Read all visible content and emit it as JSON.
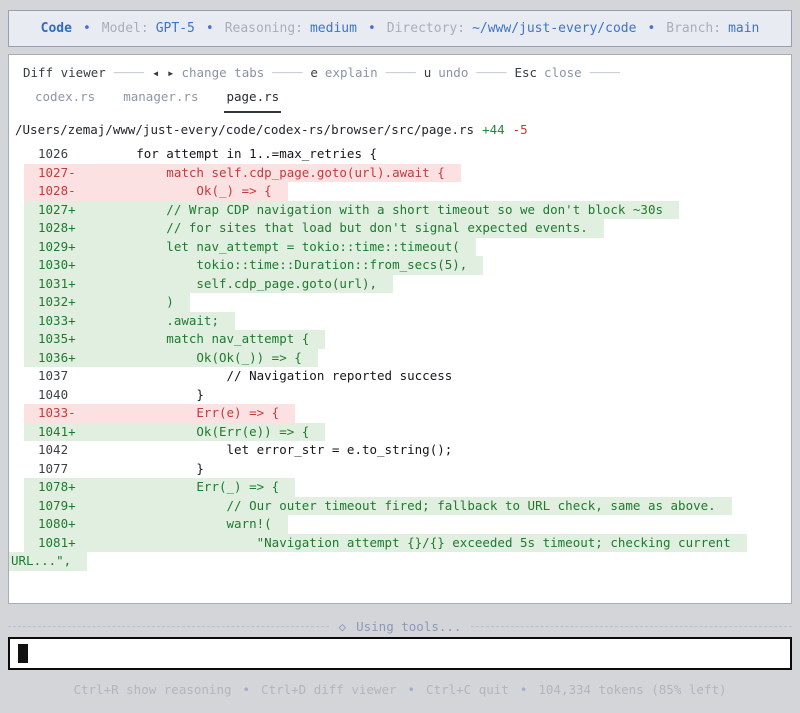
{
  "header": {
    "app": "Code",
    "bullet": "•",
    "items": [
      {
        "label": "Model:",
        "value": "GPT-5"
      },
      {
        "label": "Reasoning:",
        "value": "medium"
      },
      {
        "label": "Directory:",
        "value": "~/www/just-every/code"
      },
      {
        "label": "Branch:",
        "value": "main"
      }
    ]
  },
  "diff_viewer": {
    "title": "Diff viewer",
    "dash": "────",
    "hints": [
      {
        "key": "◂ ▸",
        "action": "change tabs"
      },
      {
        "key": "e",
        "action": "explain"
      },
      {
        "key": "u",
        "action": "undo"
      },
      {
        "key": "Esc",
        "action": "close"
      }
    ],
    "tabs": [
      {
        "label": "codex.rs"
      },
      {
        "label": "manager.rs"
      },
      {
        "label": "page.rs"
      }
    ],
    "file_path": "/Users/zemaj/www/just-every/code/codex-rs/browser/src/page.rs",
    "additions": "+44",
    "deletions": "-5",
    "lines": [
      {
        "num": "1026",
        "type": "ctx",
        "text": "        for attempt in 1..=max_retries {"
      },
      {
        "num": "1027-",
        "type": "del",
        "text": "            match self.cdp_page.goto(url).await {"
      },
      {
        "num": "1028-",
        "type": "del",
        "text": "                Ok(_) => {"
      },
      {
        "num": "1027+",
        "type": "add",
        "text": "            // Wrap CDP navigation with a short timeout so we don't block ~30s"
      },
      {
        "num": "1028+",
        "type": "add",
        "text": "            // for sites that load but don't signal expected events."
      },
      {
        "num": "1029+",
        "type": "add",
        "text": "            let nav_attempt = tokio::time::timeout("
      },
      {
        "num": "1030+",
        "type": "add",
        "text": "                tokio::time::Duration::from_secs(5),"
      },
      {
        "num": "1031+",
        "type": "add",
        "text": "                self.cdp_page.goto(url),"
      },
      {
        "num": "1032+",
        "type": "add",
        "text": "            )"
      },
      {
        "num": "1033+",
        "type": "add",
        "text": "            .await;"
      },
      {
        "num": "1035+",
        "type": "add",
        "text": "            match nav_attempt {"
      },
      {
        "num": "1036+",
        "type": "add",
        "text": "                Ok(Ok(_)) => {"
      },
      {
        "num": "1037",
        "type": "ctx",
        "text": "                    // Navigation reported success"
      },
      {
        "num": "1040",
        "type": "ctx",
        "text": "                }"
      },
      {
        "num": "1033-",
        "type": "del",
        "text": "                Err(e) => {"
      },
      {
        "num": "1041+",
        "type": "add",
        "text": "                Ok(Err(e)) => {"
      },
      {
        "num": "1042",
        "type": "ctx",
        "text": "                    let error_str = e.to_string();"
      },
      {
        "num": "1077",
        "type": "ctx",
        "text": "                }"
      },
      {
        "num": "1078+",
        "type": "add",
        "text": "                Err(_) => {"
      },
      {
        "num": "1079+",
        "type": "add",
        "text": "                    // Our outer timeout fired; fallback to URL check, same as above."
      },
      {
        "num": "1080+",
        "type": "add",
        "text": "                    warn!("
      },
      {
        "num": "1081+",
        "type": "add",
        "text": "                        \"Navigation attempt {}/{} exceeded 5s timeout; checking current"
      },
      {
        "num": "",
        "type": "add",
        "wrap": true,
        "text": "URL...\","
      }
    ]
  },
  "status_line": {
    "icon": "◇",
    "text": "Using tools..."
  },
  "input": {
    "value": ""
  },
  "footer": {
    "bullet": "•",
    "items": [
      "Ctrl+R show reasoning",
      "Ctrl+D diff viewer",
      "Ctrl+C quit",
      "104,334 tokens (85% left)"
    ]
  }
}
